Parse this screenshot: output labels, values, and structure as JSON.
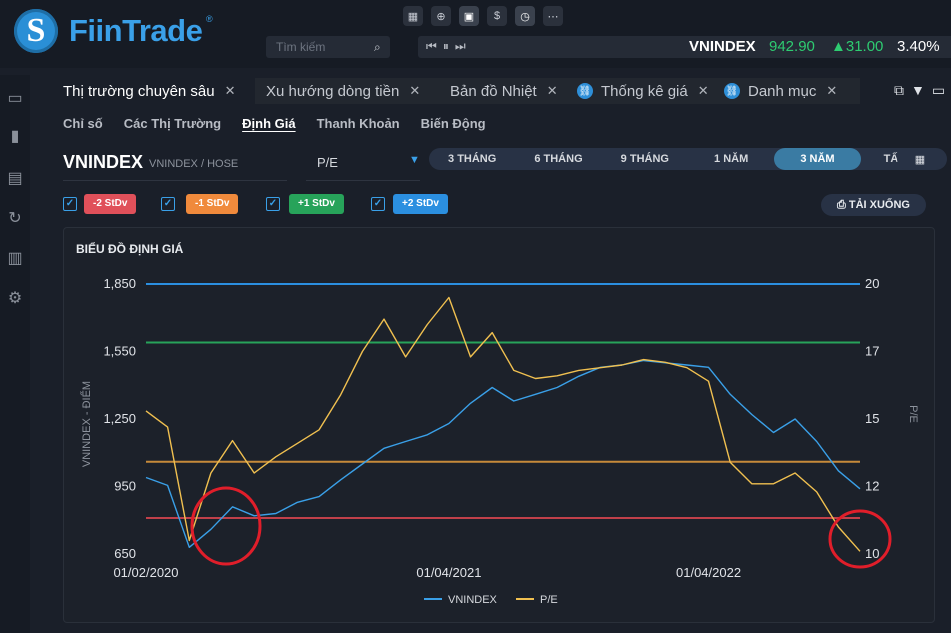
{
  "app": {
    "logo_glyph": "S",
    "name": "FiinTrade",
    "reg": "®",
    "search_placeholder": "Tìm kiếm",
    "toolbar_icons": [
      "calculator-icon",
      "search-zoom-icon",
      "gift-icon",
      "dollar-icon",
      "clock-icon",
      "more-icon"
    ]
  },
  "ticker": {
    "name": "VNINDEX",
    "value": "942.90",
    "change": "▲31.00",
    "percent": "3.40%",
    "up_color": "#2ecc71"
  },
  "tabs": [
    {
      "label": "Thị trường chuyên sâu",
      "close": "✕",
      "active": true
    },
    {
      "label": "Xu hướng dòng tiền",
      "close": "✕"
    },
    {
      "label": "Bản đồ Nhiệt",
      "close": "✕"
    },
    {
      "label": "Thống kê giá",
      "close": "✕",
      "icon": "link-icon"
    },
    {
      "label": "Danh mục",
      "close": "✕",
      "icon": "link-icon"
    }
  ],
  "subtabs": [
    "Chỉ số",
    "Các Thị Trường",
    "Định Giá",
    "Thanh Khoản",
    "Biến Động"
  ],
  "controls": {
    "symbol": "VNINDEX",
    "symbol_sub": "VNINDEX / HOSE",
    "metric": "P/E",
    "periods": [
      "3 THÁNG",
      "6 THÁNG",
      "9 THÁNG",
      "1 NĂM",
      "3 NĂM",
      "TẤT CẢ"
    ],
    "active_period": "3 NĂM"
  },
  "stdev": [
    {
      "label": "-2 StDv",
      "color": "#e0505a"
    },
    {
      "label": "-1 StDv",
      "color": "#f08a3c"
    },
    {
      "label": "+1 StDv",
      "color": "#27a35a"
    },
    {
      "label": "+2 StDv",
      "color": "#2b8fe0"
    }
  ],
  "download_label": "TẢI XUỐNG",
  "chart_data": {
    "type": "line",
    "title": "BIỂU ĐỒ ĐỊNH GIÁ",
    "ylabel": "VNINDEX - ĐIỂM",
    "y2label": "P/E",
    "ylim": [
      650,
      1850
    ],
    "y2lim": [
      10,
      20
    ],
    "yticks": [
      "1,850",
      "1,550",
      "1,250",
      "950",
      "650"
    ],
    "y2ticks": [
      "20",
      "17",
      "15",
      "12",
      "10"
    ],
    "xticks": [
      "01/02/2020",
      "01/04/2021",
      "01/04/2022"
    ],
    "x_dates": [
      "2020-02",
      "2020-03",
      "2020-04",
      "2020-05",
      "2020-06",
      "2020-07",
      "2020-08",
      "2020-09",
      "2020-10",
      "2020-11",
      "2020-12",
      "2021-01",
      "2021-02",
      "2021-03",
      "2021-04",
      "2021-05",
      "2021-06",
      "2021-07",
      "2021-08",
      "2021-09",
      "2021-10",
      "2021-11",
      "2021-12",
      "2022-01",
      "2022-02",
      "2022-03",
      "2022-04",
      "2022-05",
      "2022-06",
      "2022-07",
      "2022-08",
      "2022-09",
      "2022-10",
      "2022-11"
    ],
    "series": [
      {
        "name": "VNINDEX",
        "color": "#3aa0e8",
        "axis": "left",
        "values": [
          990,
          955,
          680,
          760,
          860,
          820,
          830,
          880,
          905,
          980,
          1050,
          1120,
          1150,
          1180,
          1230,
          1320,
          1390,
          1330,
          1360,
          1390,
          1440,
          1480,
          1490,
          1510,
          1500,
          1490,
          1480,
          1360,
          1270,
          1190,
          1250,
          1150,
          1020,
          940
        ]
      },
      {
        "name": "P/E",
        "color": "#f0c050",
        "axis": "right",
        "values": [
          15.3,
          14.7,
          10.5,
          13.0,
          14.2,
          13.0,
          13.6,
          14.1,
          14.6,
          15.9,
          17.5,
          18.7,
          17.3,
          18.5,
          19.5,
          17.3,
          18.2,
          16.8,
          16.5,
          16.6,
          16.8,
          16.9,
          17.0,
          17.2,
          17.1,
          16.9,
          16.4,
          13.4,
          12.6,
          12.6,
          13.0,
          12.3,
          11.0,
          10.1
        ]
      }
    ],
    "bands": [
      {
        "label": "+2 StDv",
        "value": 1850,
        "color": "#2b8fe0"
      },
      {
        "label": "+1 StDv",
        "value": 1590,
        "color": "#27a35a"
      },
      {
        "label": "-1 StDv",
        "value": 1060,
        "color": "#c68a3a"
      },
      {
        "label": "-2 StDv",
        "value": 810,
        "color": "#c0404a"
      }
    ],
    "legend_position": "bottom",
    "highlight_circles": 2
  }
}
